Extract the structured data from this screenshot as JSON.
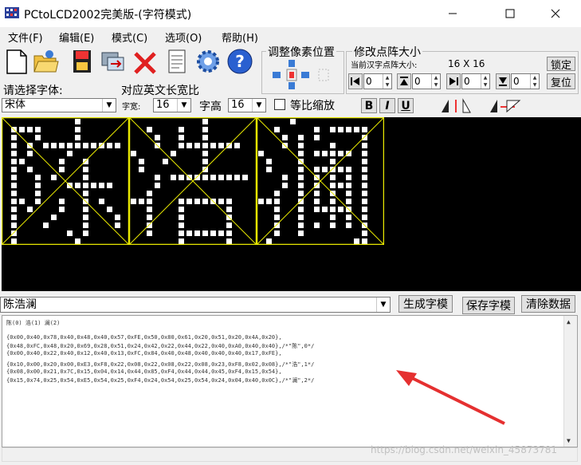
{
  "window": {
    "title": "PCtoLCD2002完美版-(字符模式)"
  },
  "menu": [
    "文件(F)",
    "编辑(E)",
    "模式(C)",
    "选项(O)",
    "帮助(H)"
  ],
  "toolbar_icons": [
    "new-file-icon",
    "open-folder-icon",
    "save-icon",
    "export-icon",
    "delete-icon",
    "notes-icon",
    "settings-gear-icon",
    "help-icon"
  ],
  "font_area": {
    "choose_font_label": "请选择字体:",
    "font_value": "宋体",
    "ratio_label": "对应英文长宽比",
    "width_label": "字宽:",
    "width_value": "16",
    "height_label": "字高",
    "height_value": "16",
    "proportional_label": "等比缩放",
    "bold": "B",
    "italic": "I",
    "underline": "U"
  },
  "pixel_pos": {
    "title": "调整像素位置"
  },
  "matrix": {
    "title": "修改点阵大小",
    "current_label": "当前汉字点阵大小:",
    "size_text": "16 X 16",
    "lock_label": "锁定",
    "reset_label": "复位",
    "spins": [
      "0",
      "0",
      "0",
      "0"
    ]
  },
  "input": {
    "text": "陈浩澜",
    "generate_label": "生成字模",
    "save_label": "保存字模",
    "clear_label": "清除数据"
  },
  "output": {
    "header": "陈(0) 浩(1) 澜(2)",
    "lines": [
      "{0x00,0x40,0x78,0x40,0x48,0x40,0x57,0xFE,0x50,0x80,0x61,0x20,0x51,0x20,0x4A,0x20},",
      "{0x48,0xFC,0x48,0x20,0x69,0x28,0x51,0x24,0x42,0x22,0x44,0x22,0x40,0xA0,0x40,0x40},/*\"陈\",0*/",
      "{0x00,0x40,0x22,0x40,0x12,0x40,0x13,0xFC,0x84,0x40,0x48,0x40,0x40,0x40,0x17,0xFE},",
      "{0x10,0x00,0x20,0x00,0xE3,0xF8,0x22,0x08,0x22,0x08,0x22,0x08,0x23,0xF8,0x02,0x08},/*\"浩\",1*/",
      "{0x08,0x00,0x21,0x7C,0x15,0x04,0x14,0x44,0x85,0xF4,0x44,0x44,0x45,0xF4,0x15,0x54},",
      "{0x15,0x74,0x25,0x54,0xE5,0x54,0x25,0xF4,0x24,0x54,0x25,0x54,0x24,0x04,0x40,0x0C},/*\"澜\",2*/"
    ]
  },
  "watermark": "https://blog.csdn.net/weixin_45873781"
}
